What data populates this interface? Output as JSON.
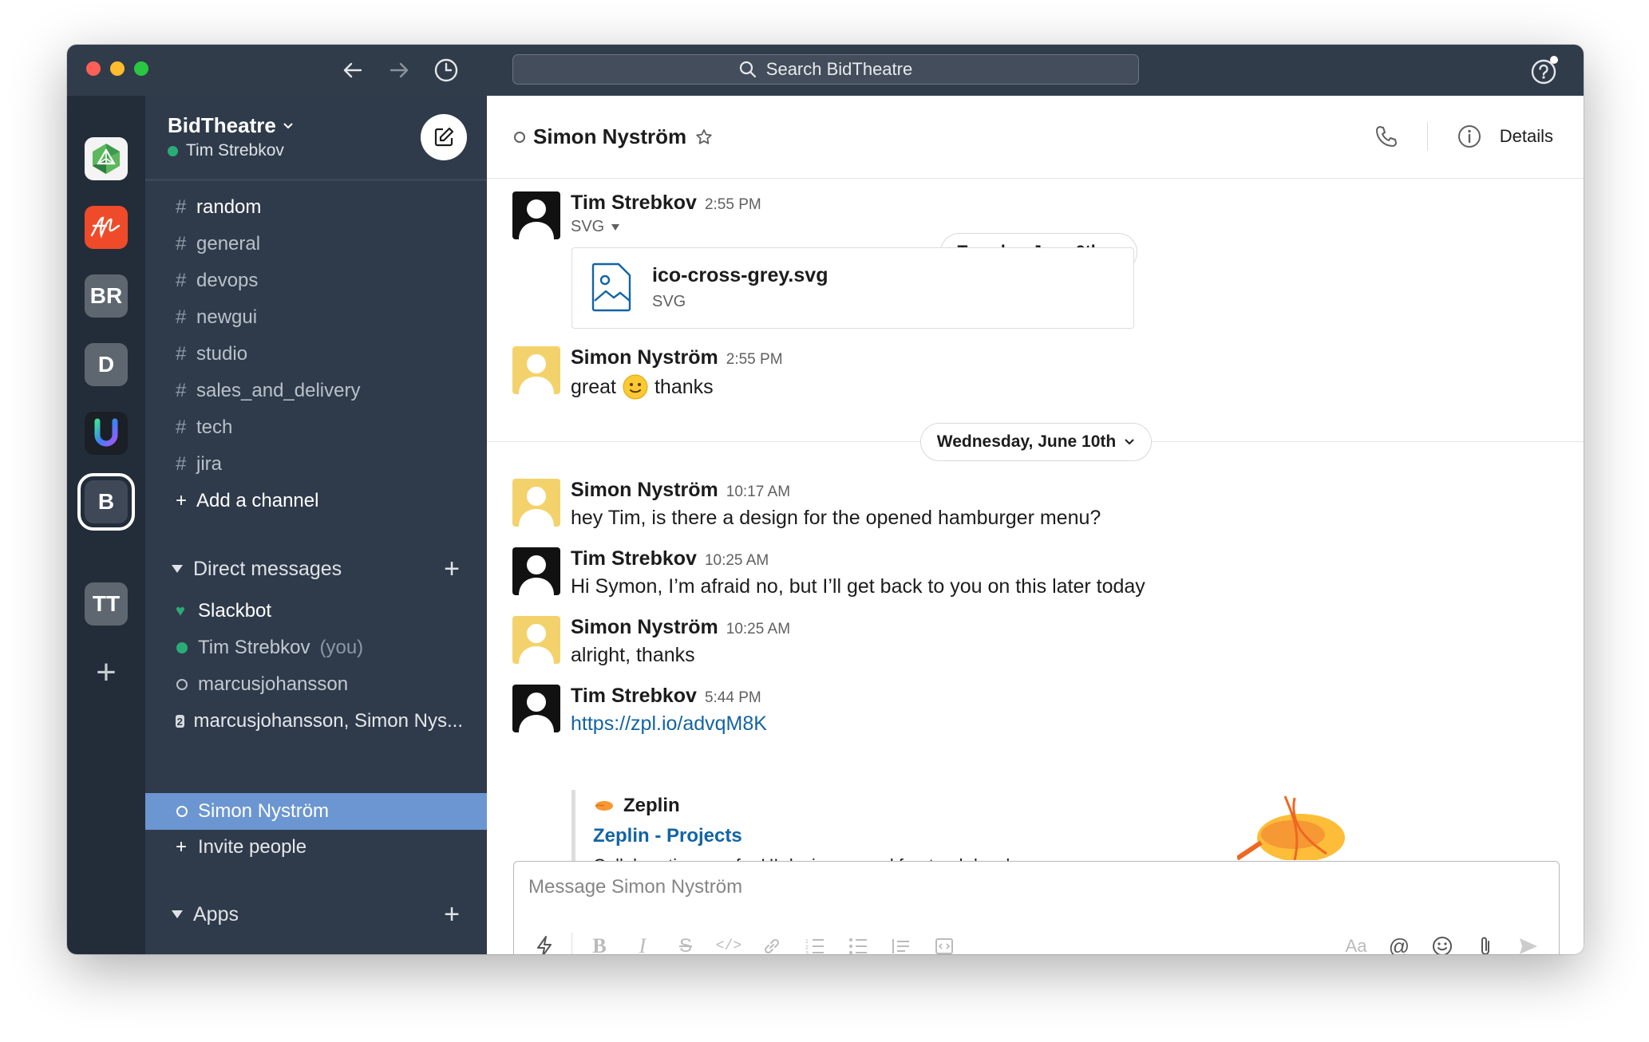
{
  "search": {
    "placeholder": "Search BidTheatre"
  },
  "workspaces": [
    {
      "label": ""
    },
    {
      "label": ""
    },
    {
      "label": "BR"
    },
    {
      "label": "D"
    },
    {
      "label": ""
    },
    {
      "label": "B"
    },
    {
      "label": "TT"
    }
  ],
  "sidebar": {
    "team_name": "BidTheatre",
    "user_name": "Tim Strebkov",
    "channels": [
      {
        "name": "random"
      },
      {
        "name": "general"
      },
      {
        "name": "devops"
      },
      {
        "name": "newgui"
      },
      {
        "name": "studio"
      },
      {
        "name": "sales_and_delivery"
      },
      {
        "name": "tech"
      },
      {
        "name": "jira"
      }
    ],
    "add_channel": "Add a channel",
    "dm_header": "Direct messages",
    "dms": [
      {
        "name": "Slackbot"
      },
      {
        "name": "Tim Strebkov"
      },
      {
        "name": "marcusjohansson"
      },
      {
        "name": "marcusjohansson, Simon Nys..."
      },
      {
        "name": "Simon Nyström"
      }
    ],
    "you_label": "(you)",
    "group_count": "2",
    "invite": "Invite people",
    "apps_header": "Apps"
  },
  "header": {
    "channel_name": "Simon Nyström",
    "details_label": "Details"
  },
  "messages": {
    "m1": {
      "author": "Tim Strebkov",
      "time": "2:55 PM",
      "filetype": "SVG",
      "file_name": "ico-cross-grey.svg",
      "file_type": "SVG"
    },
    "date1": "Tuesday, June 9th",
    "m2": {
      "author": "Simon Nyström",
      "time": "2:55 PM",
      "text_a": "great",
      "text_b": "thanks"
    },
    "date2": "Wednesday, June 10th",
    "m3": {
      "author": "Simon Nyström",
      "time": "10:17 AM",
      "text": "hey Tim, is there a design for the opened hamburger menu?"
    },
    "m4": {
      "author": "Tim Strebkov",
      "time": "10:25 AM",
      "text": "Hi Symon, I’m afraid no, but I’ll get back to you on this later today"
    },
    "m5": {
      "author": "Simon Nyström",
      "time": "10:25 AM",
      "text": "alright, thanks"
    },
    "m6": {
      "author": "Tim Strebkov",
      "time": "5:44 PM",
      "link": "https://zpl.io/advqM8K",
      "unfurl_site": "Zeplin",
      "unfurl_title": "Zeplin - Projects",
      "unfurl_desc": "Collaboration app for UI designers and frontend developers"
    }
  },
  "composer": {
    "placeholder": "Message Simon Nyström",
    "format_label": "Aa"
  },
  "colors": {
    "sidebar": "#2f3b4b",
    "rail": "#232d3a",
    "active": "#6b96d1",
    "link": "#1264a3",
    "presence": "#2bac76"
  }
}
